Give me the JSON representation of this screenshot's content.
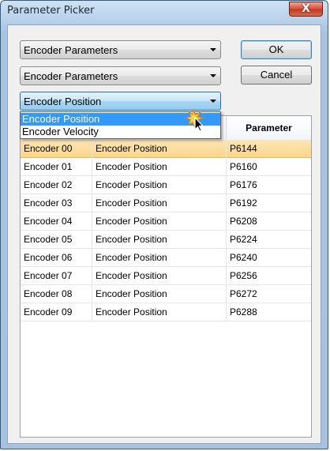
{
  "window": {
    "title": "Parameter Picker",
    "close_glyph": "X"
  },
  "combos": [
    {
      "value": "Encoder Parameters"
    },
    {
      "value": "Encoder Parameters"
    },
    {
      "value": "Encoder Position"
    }
  ],
  "buttons": {
    "ok_label": "OK",
    "cancel_label": "Cancel"
  },
  "dropdown": {
    "options": [
      "Encoder Position",
      "Encoder Velocity"
    ],
    "highlighted_index": 0
  },
  "grid": {
    "columns": [
      "",
      "",
      "Parameter"
    ],
    "selected_row": 0,
    "rows": [
      [
        "Encoder 00",
        "Encoder Position",
        "P6144"
      ],
      [
        "Encoder 01",
        "Encoder Position",
        "P6160"
      ],
      [
        "Encoder 02",
        "Encoder Position",
        "P6176"
      ],
      [
        "Encoder 03",
        "Encoder Position",
        "P6192"
      ],
      [
        "Encoder 04",
        "Encoder Position",
        "P6208"
      ],
      [
        "Encoder 05",
        "Encoder Position",
        "P6224"
      ],
      [
        "Encoder 06",
        "Encoder Position",
        "P6240"
      ],
      [
        "Encoder 07",
        "Encoder Position",
        "P6256"
      ],
      [
        "Encoder 08",
        "Encoder Position",
        "P6272"
      ],
      [
        "Encoder 09",
        "Encoder Position",
        "P6288"
      ]
    ]
  },
  "colors": {
    "selection_row": "#fbd58a",
    "dropdown_highlight": "#3399ff",
    "close_button": "#c43a1f"
  },
  "icons": {
    "cursor": "mouse-pointer-click-icon",
    "combo_arrow": "chevron-down-icon"
  }
}
